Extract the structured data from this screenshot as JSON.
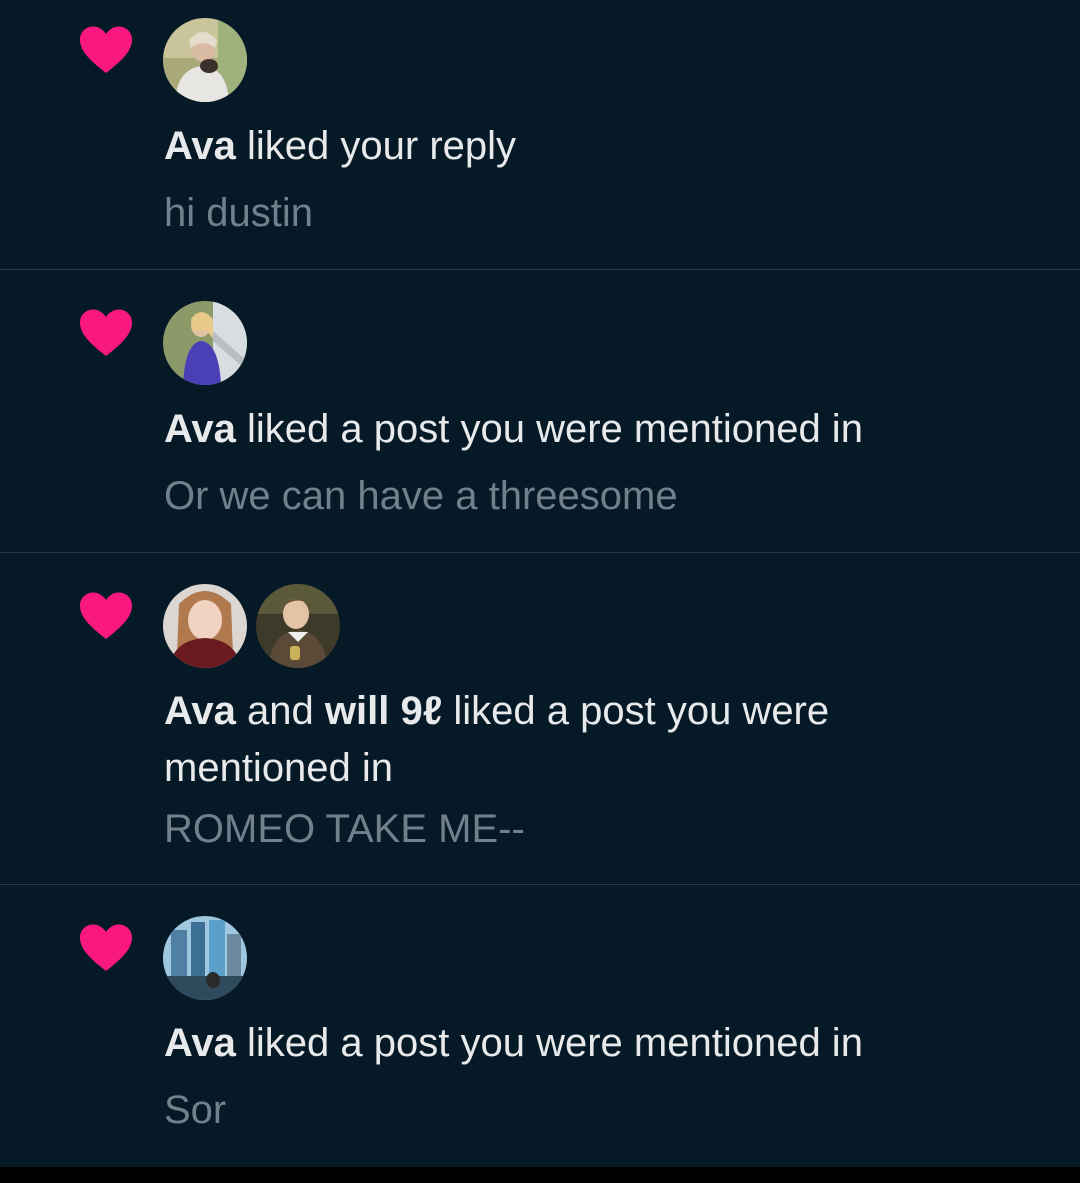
{
  "colors": {
    "background": "#061927",
    "heart": "#f91880",
    "primary_text": "#e7e9ea",
    "secondary_text": "#71808b",
    "divider": "#2b3a46"
  },
  "notifications": [
    {
      "icon": "heart-icon",
      "actor1": "Ava",
      "action": " liked your reply",
      "snippet": "hi dustin"
    },
    {
      "icon": "heart-icon",
      "actor1": "Ava",
      "action": " liked a post you were mentioned in",
      "snippet": "Or we can have a threesome"
    },
    {
      "icon": "heart-icon",
      "actor1": "Ava",
      "joiner": " and ",
      "actor2": "will 9ℓ",
      "action": " liked a post you were mentioned in",
      "snippet": "ROMEO TAKE ME--"
    },
    {
      "icon": "heart-icon",
      "actor1": "Ava",
      "action": " liked a post you were mentioned in",
      "snippet": "Sor"
    }
  ]
}
